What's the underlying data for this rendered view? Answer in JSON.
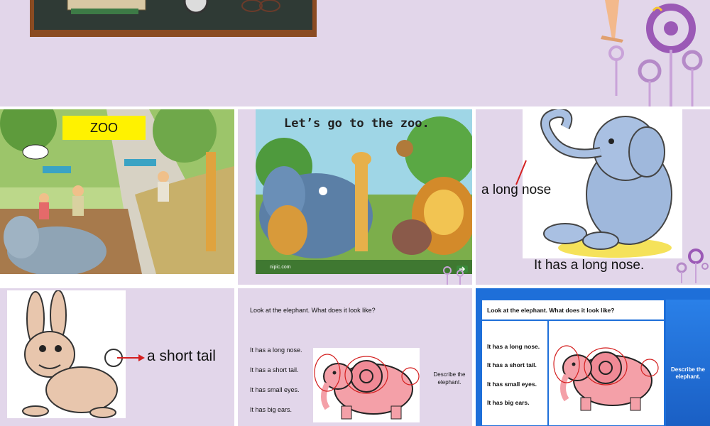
{
  "slide2": {
    "banner": "ZOO"
  },
  "slide3": {
    "title": "Let’s go to the zoo.",
    "watermark": "nipic.com"
  },
  "slide4": {
    "label": "a long nose",
    "caption": "It has a long nose."
  },
  "slide5": {
    "label": "a short tail"
  },
  "slide6": {
    "question": "Look at the elephant.  What does it look like?",
    "items": [
      "It has a long nose.",
      "It has a short tail.",
      "It has small eyes.",
      "It has big ears."
    ],
    "describe": "Describe the elephant."
  },
  "slide7": {
    "question": "Look at the elephant.  What does it look like?",
    "items": [
      "It has a long nose.",
      "It has a short tail.",
      "It has small eyes.",
      "It has big ears."
    ],
    "describe": "Describe the elephant."
  },
  "colors": {
    "slide_bg": "#e2d6ea",
    "accent_purple": "#9b59b6",
    "banner_yellow": "#fff200",
    "blue_frame": "#1e6fd9"
  }
}
